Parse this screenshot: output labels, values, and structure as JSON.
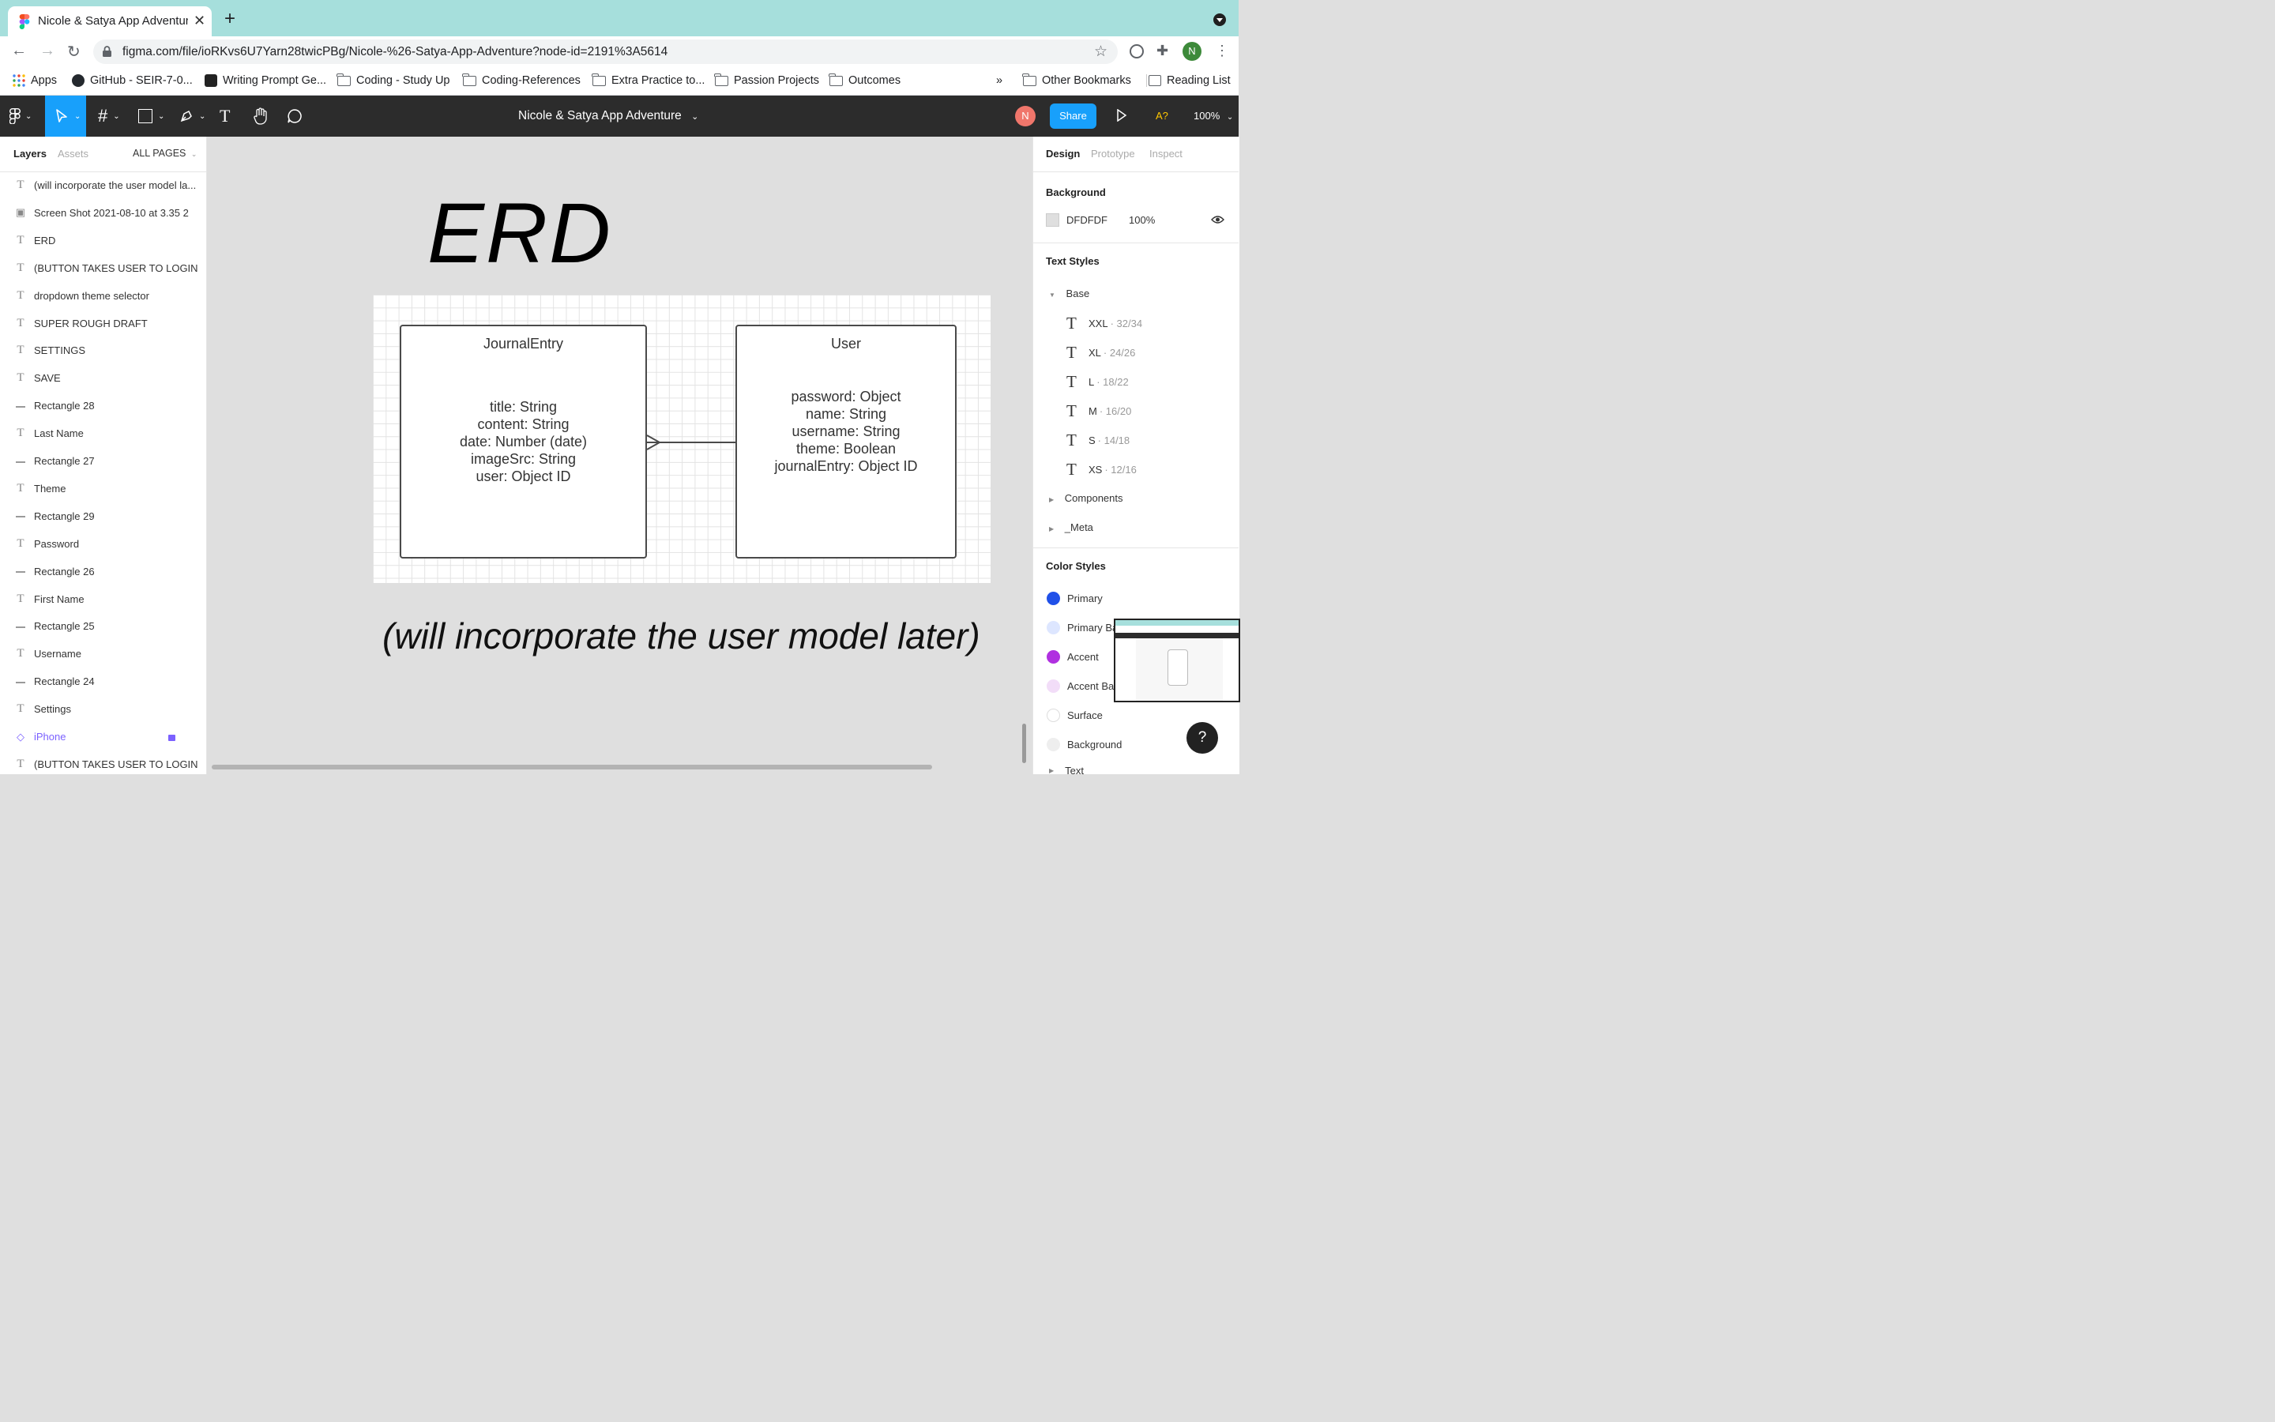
{
  "browser": {
    "tab_title": "Nicole & Satya App Adventure",
    "url": "figma.com/file/ioRKvs6U7Yarn28twicPBg/Nicole-%26-Satya-App-Adventure?node-id=2191%3A5614",
    "profile_initial": "N",
    "bookmarks": [
      "Apps",
      "GitHub - SEIR-7-0...",
      "Writing Prompt Ge...",
      "Coding - Study Up",
      "Coding-References",
      "Extra Practice to...",
      "Passion Projects",
      "Outcomes"
    ],
    "overflow": "»",
    "other_bookmarks": "Other Bookmarks",
    "reading_list": "Reading List"
  },
  "figma": {
    "file_title": "Nicole & Satya App Adventure",
    "user_initial": "N",
    "share_label": "Share",
    "a11y_label": "A?",
    "zoom": "100%"
  },
  "left_panel": {
    "tabs": [
      "Layers",
      "Assets"
    ],
    "pages_label": "ALL PAGES",
    "layers": [
      {
        "type": "text",
        "name": "(will incorporate the user model la..."
      },
      {
        "type": "image",
        "name": "Screen Shot 2021-08-10 at 3.35 2"
      },
      {
        "type": "text",
        "name": "ERD"
      },
      {
        "type": "text",
        "name": "(BUTTON TAKES USER TO LOGIN ..."
      },
      {
        "type": "text",
        "name": "dropdown theme selector"
      },
      {
        "type": "text",
        "name": "SUPER ROUGH DRAFT"
      },
      {
        "type": "text",
        "name": "SETTINGS"
      },
      {
        "type": "text",
        "name": "SAVE"
      },
      {
        "type": "line",
        "name": "Rectangle 28"
      },
      {
        "type": "text",
        "name": "Last Name"
      },
      {
        "type": "line",
        "name": "Rectangle 27"
      },
      {
        "type": "text",
        "name": "Theme"
      },
      {
        "type": "line",
        "name": "Rectangle 29"
      },
      {
        "type": "text",
        "name": "Password"
      },
      {
        "type": "line",
        "name": "Rectangle 26"
      },
      {
        "type": "text",
        "name": "First Name"
      },
      {
        "type": "line",
        "name": "Rectangle 25"
      },
      {
        "type": "text",
        "name": "Username"
      },
      {
        "type": "line",
        "name": "Rectangle 24"
      },
      {
        "type": "text",
        "name": "Settings"
      },
      {
        "type": "component",
        "name": "iPhone"
      },
      {
        "type": "text",
        "name": "(BUTTON TAKES USER TO LOGIN ..."
      }
    ]
  },
  "canvas": {
    "title": "ERD",
    "journal_entity": {
      "name": "JournalEntry",
      "fields": [
        "title: String",
        "content: String",
        "date: Number (date)",
        "imageSrc: String",
        "user: Object ID"
      ]
    },
    "user_entity": {
      "name": "User",
      "fields": [
        "password: Object",
        "name: String",
        "username: String",
        "theme: Boolean",
        "journalEntry: Object ID"
      ]
    },
    "note": "(will incorporate the user model later)"
  },
  "right_panel": {
    "tabs": [
      "Design",
      "Prototype",
      "Inspect"
    ],
    "background_label": "Background",
    "background_hex": "DFDFDF",
    "background_opacity": "100%",
    "text_styles_label": "Text Styles",
    "base_group": "Base",
    "text_styles": [
      {
        "name": "XXL",
        "meta": "· 32/34"
      },
      {
        "name": "XL",
        "meta": "· 24/26"
      },
      {
        "name": "L",
        "meta": "· 18/22"
      },
      {
        "name": "M",
        "meta": "· 16/20"
      },
      {
        "name": "S",
        "meta": "· 14/18"
      },
      {
        "name": "XS",
        "meta": "· 12/16"
      }
    ],
    "groups": [
      "Components",
      "_Meta"
    ],
    "color_styles_label": "Color Styles",
    "color_styles": [
      {
        "name": "Primary",
        "color": "#2050e8"
      },
      {
        "name": "Primary Ba",
        "color": "#dde6ff"
      },
      {
        "name": "Accent",
        "color": "#b030e0"
      },
      {
        "name": "Accent Ba",
        "color": "#f2ddf8"
      },
      {
        "name": "Surface",
        "color": "#ffffff"
      },
      {
        "name": "Background",
        "color": "#eeeeee"
      },
      {
        "name": "Text",
        "color": "#222222"
      }
    ],
    "help_label": "?"
  }
}
